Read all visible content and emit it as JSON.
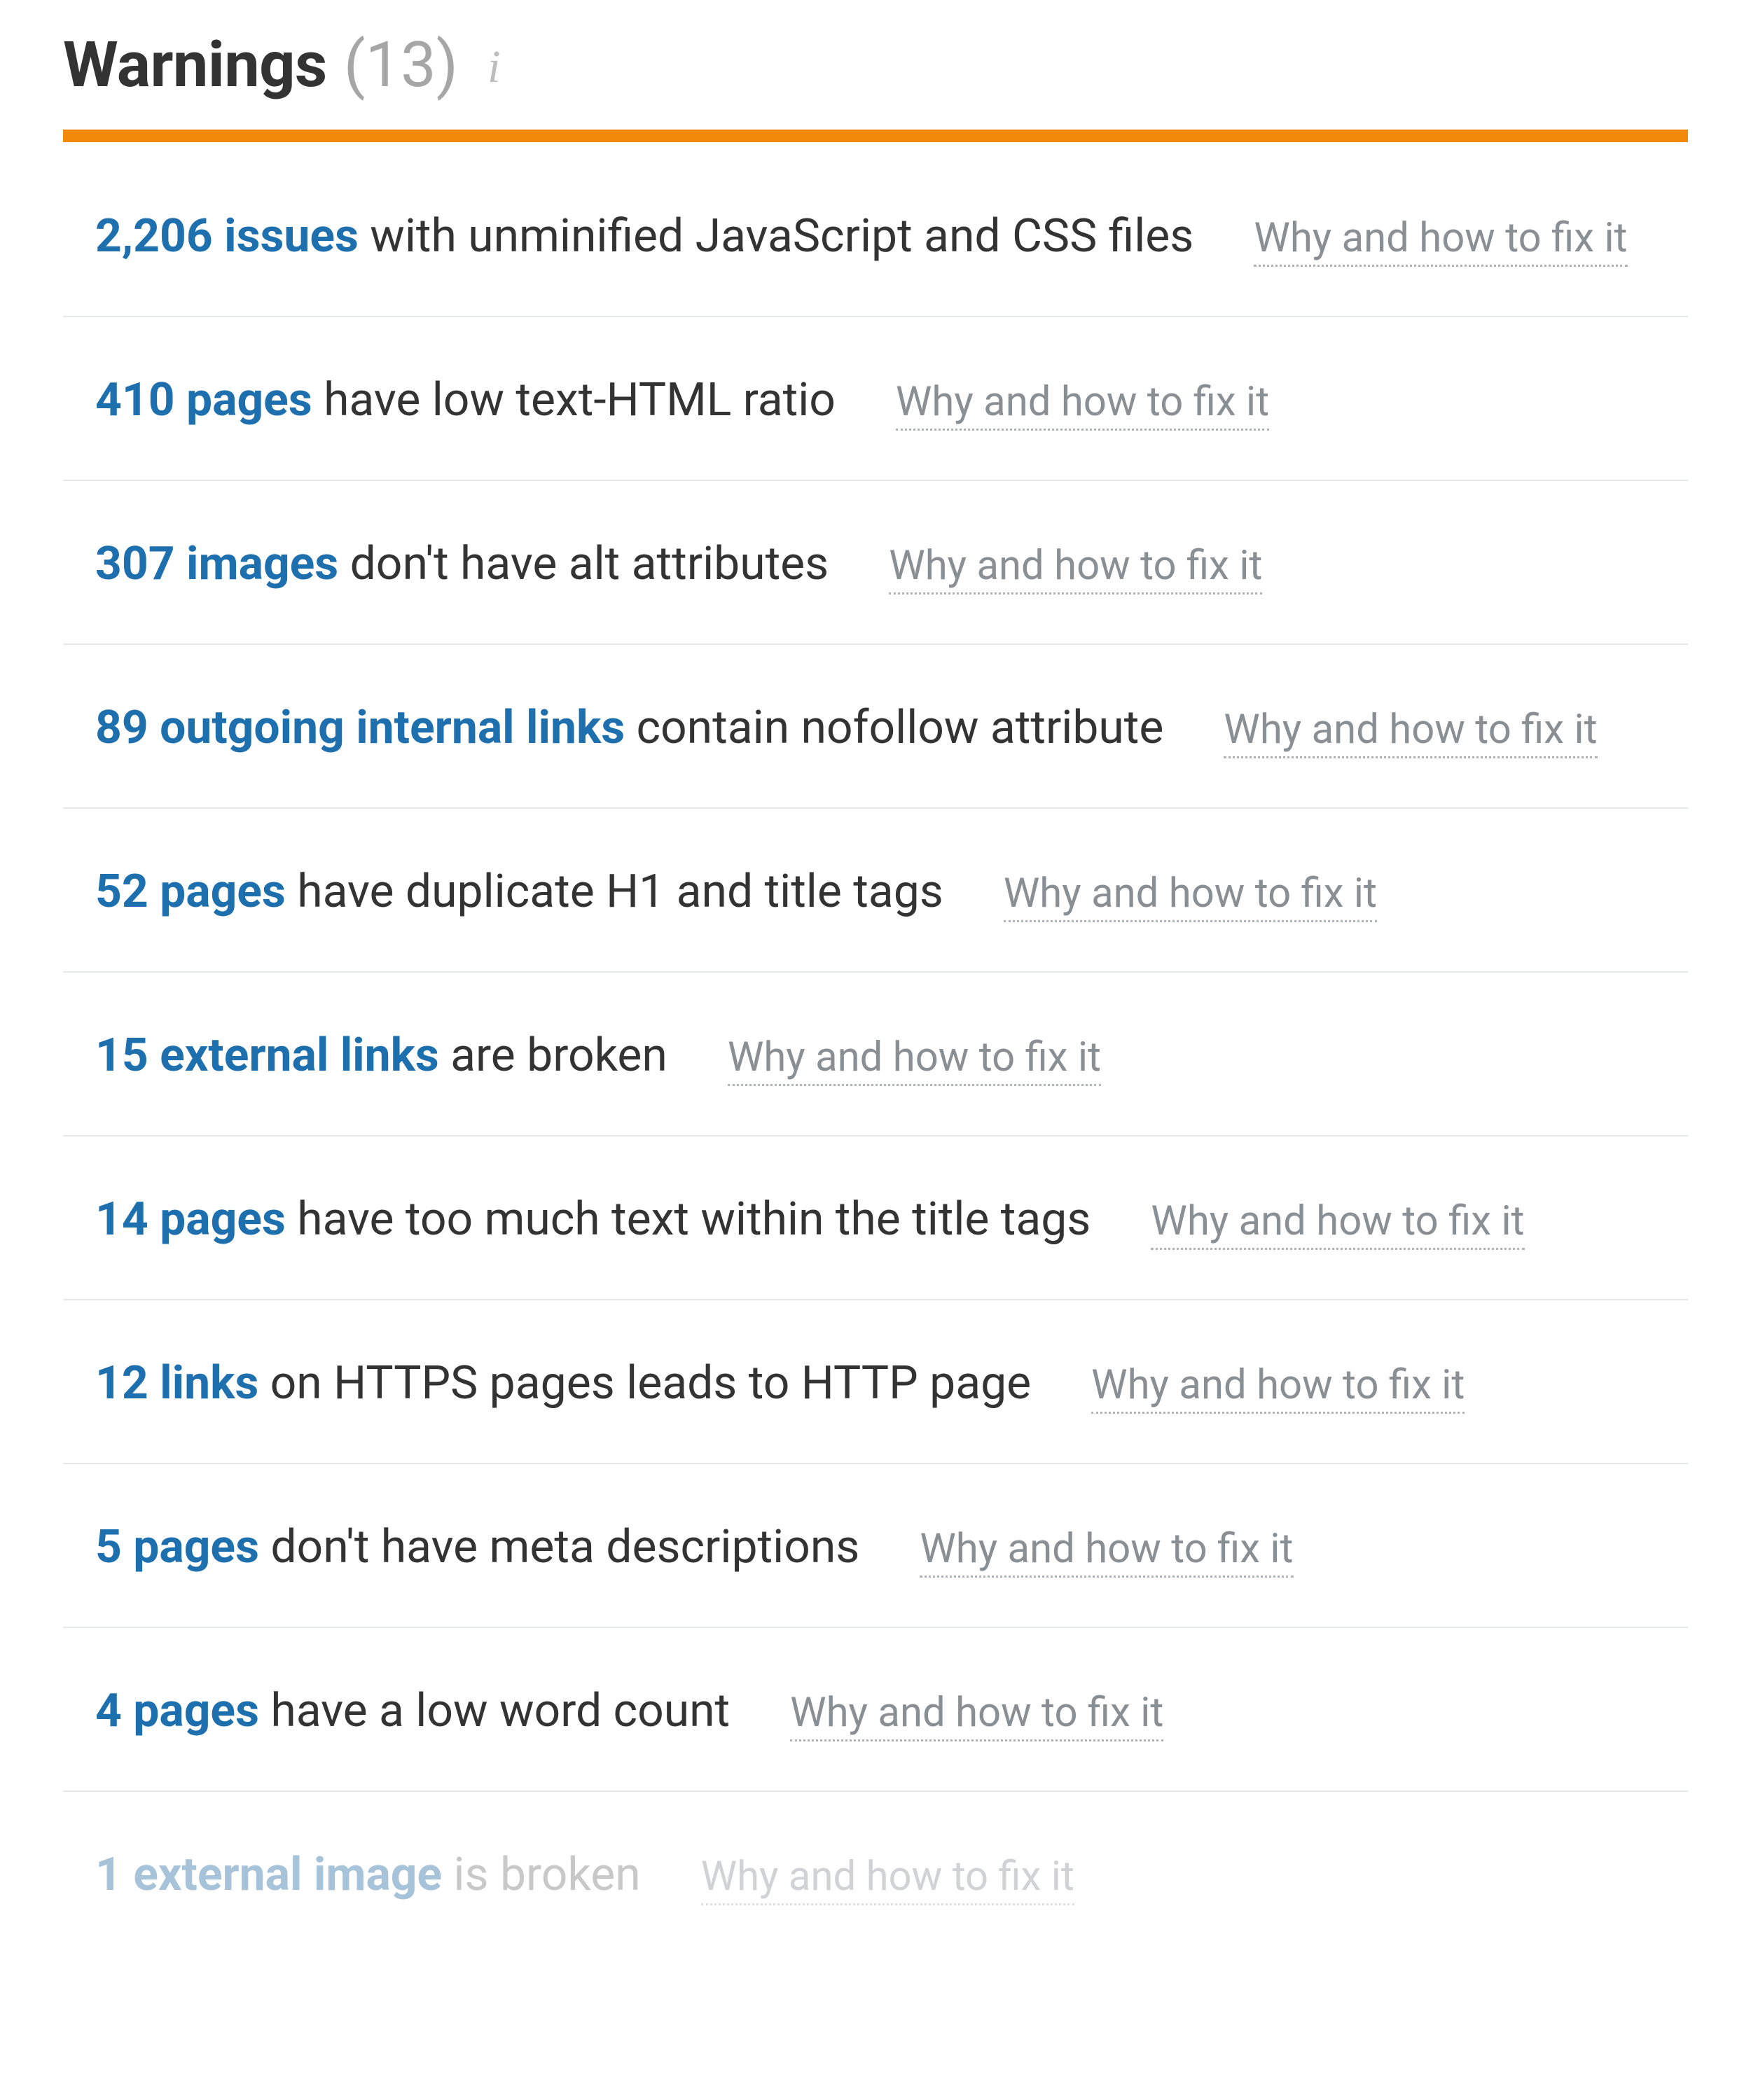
{
  "header": {
    "title": "Warnings",
    "count": "(13)"
  },
  "fix_label": "Why and how to fix it",
  "colors": {
    "accent_orange": "#f2890a",
    "link_blue": "#1e6fae",
    "muted_gray": "#8a8f93"
  },
  "warnings": [
    {
      "link": "2,206 issues",
      "rest": " with unminified JavaScript and CSS files"
    },
    {
      "link": "410 pages",
      "rest": " have low text-HTML ratio"
    },
    {
      "link": "307 images",
      "rest": " don't have alt attributes"
    },
    {
      "link": "89 outgoing internal links",
      "rest": " contain nofollow attribute"
    },
    {
      "link": "52 pages",
      "rest": " have duplicate H1 and title tags"
    },
    {
      "link": "15 external links",
      "rest": " are broken"
    },
    {
      "link": "14 pages",
      "rest": " have too much text within the title tags"
    },
    {
      "link": "12 links",
      "rest": " on HTTPS pages leads to HTTP page"
    },
    {
      "link": "5 pages",
      "rest": " don't have meta descriptions"
    },
    {
      "link": "4 pages",
      "rest": " have a low word count"
    },
    {
      "link": "1 external image",
      "rest": " is broken",
      "faded": true
    }
  ]
}
